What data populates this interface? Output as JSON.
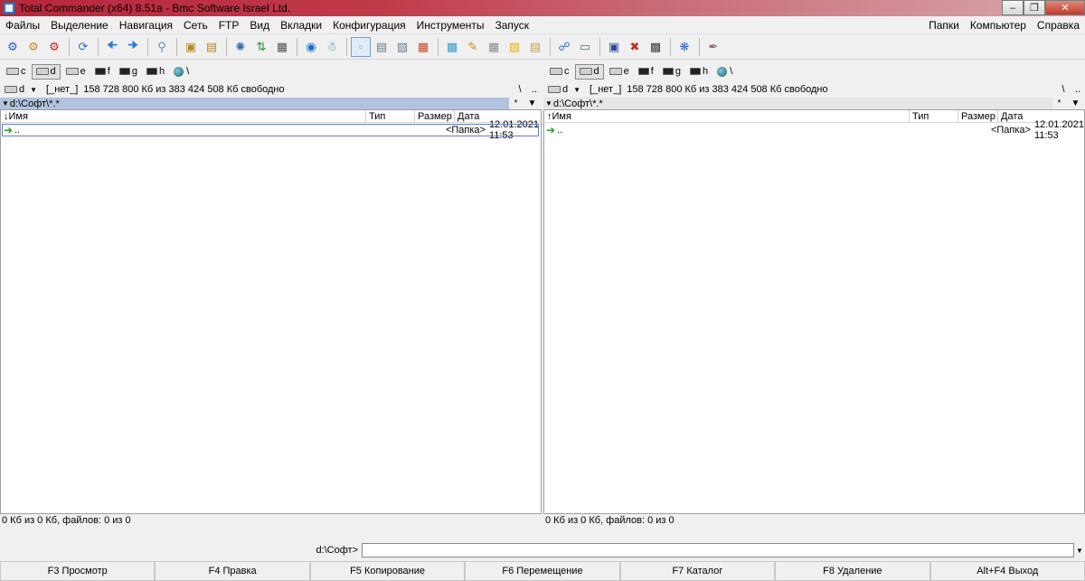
{
  "window": {
    "title": "Total Commander (x64) 8.51a - Bmc Software Israel Ltd."
  },
  "menu": {
    "items": [
      "Файлы",
      "Выделение",
      "Навигация",
      "Сеть",
      "FTP",
      "Вид",
      "Вкладки",
      "Конфигурация",
      "Инструменты",
      "Запуск"
    ],
    "right_items": [
      "Папки",
      "Компьютер",
      "Справка"
    ]
  },
  "toolbar": {
    "icons": [
      "gear-blue-icon",
      "gear-orange-icon",
      "gear-red-icon",
      "refresh-icon",
      "back-icon",
      "forward-icon",
      "find-icon",
      "pack-icon",
      "unpack-icon",
      "split-icon",
      "sort-icon",
      "notepad-icon",
      "internet-icon",
      "ftp-icon",
      "view-list-icon",
      "view-brief-icon",
      "view-tree-icon",
      "view-thumbs-icon",
      "copy-icon",
      "edit-icon",
      "calc-icon",
      "notes-icon",
      "doc-icon",
      "network-icon",
      "drive-icon",
      "window-icon",
      "delete-icon",
      "cmd-icon",
      "settings-icon",
      "brush-icon"
    ]
  },
  "left": {
    "drives": [
      {
        "letter": "c",
        "type": "hdd"
      },
      {
        "letter": "d",
        "type": "hdd",
        "active": true
      },
      {
        "letter": "e",
        "type": "net"
      },
      {
        "letter": "f",
        "type": "cd"
      },
      {
        "letter": "g",
        "type": "cd"
      },
      {
        "letter": "h",
        "type": "cd"
      }
    ],
    "net_label": "\\",
    "drive_combo": "d",
    "volume": "[_нет_]",
    "free_space": "158 728 800 Кб из 383 424 508 Кб свободно",
    "nav_root": "\\",
    "nav_up": "..",
    "path": "d:\\Софт\\*.*",
    "path_star": "*",
    "path_drop": "▼",
    "columns": {
      "name": "Имя",
      "ext": "Тип",
      "size": "Размер",
      "date": "Дата"
    },
    "sort_arrow": "↓",
    "rows": [
      {
        "name": "..",
        "size": "<Папка>",
        "date": "12.01.2021 11:53"
      }
    ],
    "status": "0 Кб из 0 Кб, файлов: 0 из 0"
  },
  "right": {
    "drives": [
      {
        "letter": "c",
        "type": "hdd"
      },
      {
        "letter": "d",
        "type": "hdd",
        "active": true
      },
      {
        "letter": "e",
        "type": "net"
      },
      {
        "letter": "f",
        "type": "cd"
      },
      {
        "letter": "g",
        "type": "cd"
      },
      {
        "letter": "h",
        "type": "cd"
      }
    ],
    "net_label": "\\",
    "drive_combo": "d",
    "volume": "[_нет_]",
    "free_space": "158 728 800 Кб из 383 424 508 Кб свободно",
    "nav_root": "\\",
    "nav_up": "..",
    "path": "d:\\Софт\\*.*",
    "path_star": "*",
    "path_drop": "▼",
    "columns": {
      "name": "Имя",
      "ext": "Тип",
      "size": "Размер",
      "date": "Дата"
    },
    "sort_arrow": "↑",
    "rows": [
      {
        "name": "..",
        "size": "<Папка>",
        "date": "12.01.2021 11:53"
      }
    ],
    "status": "0 Кб из 0 Кб, файлов: 0 из 0"
  },
  "cmdline": {
    "path": "d:\\Софт>",
    "value": ""
  },
  "fkeys": [
    "F3 Просмотр",
    "F4 Правка",
    "F5 Копирование",
    "F6 Перемещение",
    "F7 Каталог",
    "F8 Удаление",
    "Alt+F4 Выход"
  ]
}
